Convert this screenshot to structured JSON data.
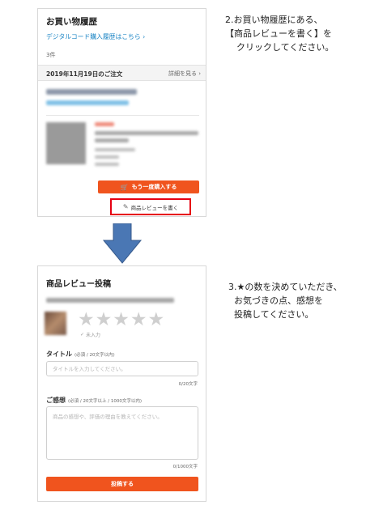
{
  "screen1": {
    "title": "お買い物履歴",
    "digital_link": "デジタルコード購入履歴はこちら",
    "count": "3件",
    "order_date": "2019年11月19日のご注文",
    "detail_link": "詳細を見る",
    "buy_again": "もう一度購入する",
    "write_review": "商品レビューを書く"
  },
  "screen2": {
    "title": "商品レビュー投稿",
    "rating_status": "未入力",
    "title_label": "タイトル",
    "title_hint": "(必須 / 20文字以内)",
    "title_placeholder": "タイトルを入力してください。",
    "title_counter": "0/20文字",
    "feedback_label": "ご感想",
    "feedback_hint": "(必須 / 20文字以上 / 1000文字以内)",
    "feedback_placeholder": "商品の感想や、評価の理由を教えてください。",
    "feedback_counter": "0/1000文字",
    "submit": "投稿する"
  },
  "instructions": {
    "step2": "2.お買い物履歴にある、\n【商品レビューを書く】を\n    クリックしてください。",
    "step3": "3.★の数を決めていただき、\n  お気づきの点、感想を\n  投稿してください。"
  },
  "colors": {
    "accent": "#f0541e",
    "link": "#1a84c4",
    "highlight": "#e60012",
    "arrow": "#4a77b4"
  }
}
